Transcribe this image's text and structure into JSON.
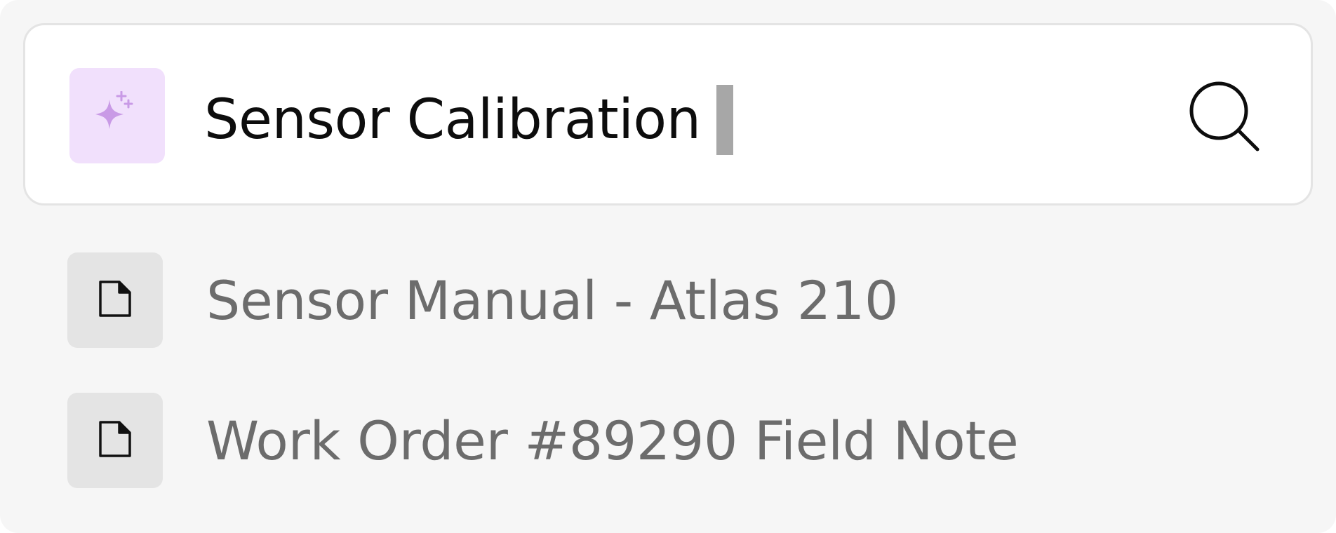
{
  "search": {
    "query": "Sensor Calibration",
    "ai_icon": "sparkles-icon",
    "search_icon": "search-icon",
    "ai_badge_color": "#f1e0fc",
    "ai_icon_color": "#c99ae6"
  },
  "results": [
    {
      "label": "Sensor Manual - Atlas 210",
      "icon": "document-icon"
    },
    {
      "label": "Work Order #89290 Field Note",
      "icon": "document-icon"
    }
  ]
}
